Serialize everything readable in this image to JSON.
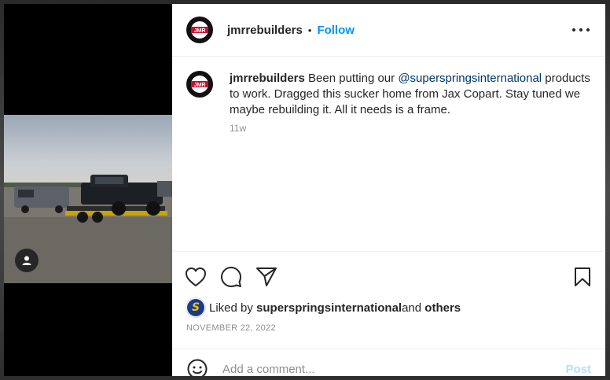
{
  "post": {
    "author": "jmrrebuilders",
    "follow_label": "Follow",
    "separator": "•",
    "avatar_text": "JMR",
    "caption_lead": "Been putting our ",
    "caption_mention": "@superspringsinternational",
    "caption_rest": " products to work. Dragged this sucker home from Jax Copart. Stay tuned we maybe rebuilding it. All it needs is a frame.",
    "time_ago": "11w",
    "liked_by_prefix": "Liked by ",
    "liked_by_user": "superspringsinternational",
    "liked_by_and": " and ",
    "liked_by_others": "others",
    "badge_letter": "S",
    "date": "NOVEMBER 22, 2022"
  },
  "comment": {
    "placeholder": "Add a comment...",
    "post_label": "Post"
  },
  "icons": {
    "more": "more-options-icon",
    "like": "heart-icon",
    "comment": "comment-bubble-icon",
    "share": "paper-plane-icon",
    "save": "bookmark-icon",
    "emoji": "emoji-icon",
    "tag": "user-tag-icon"
  },
  "colors": {
    "accent": "#0095f6",
    "mention": "#00376b",
    "post_disabled": "#b2dffc",
    "meta": "#8e8e8e"
  }
}
